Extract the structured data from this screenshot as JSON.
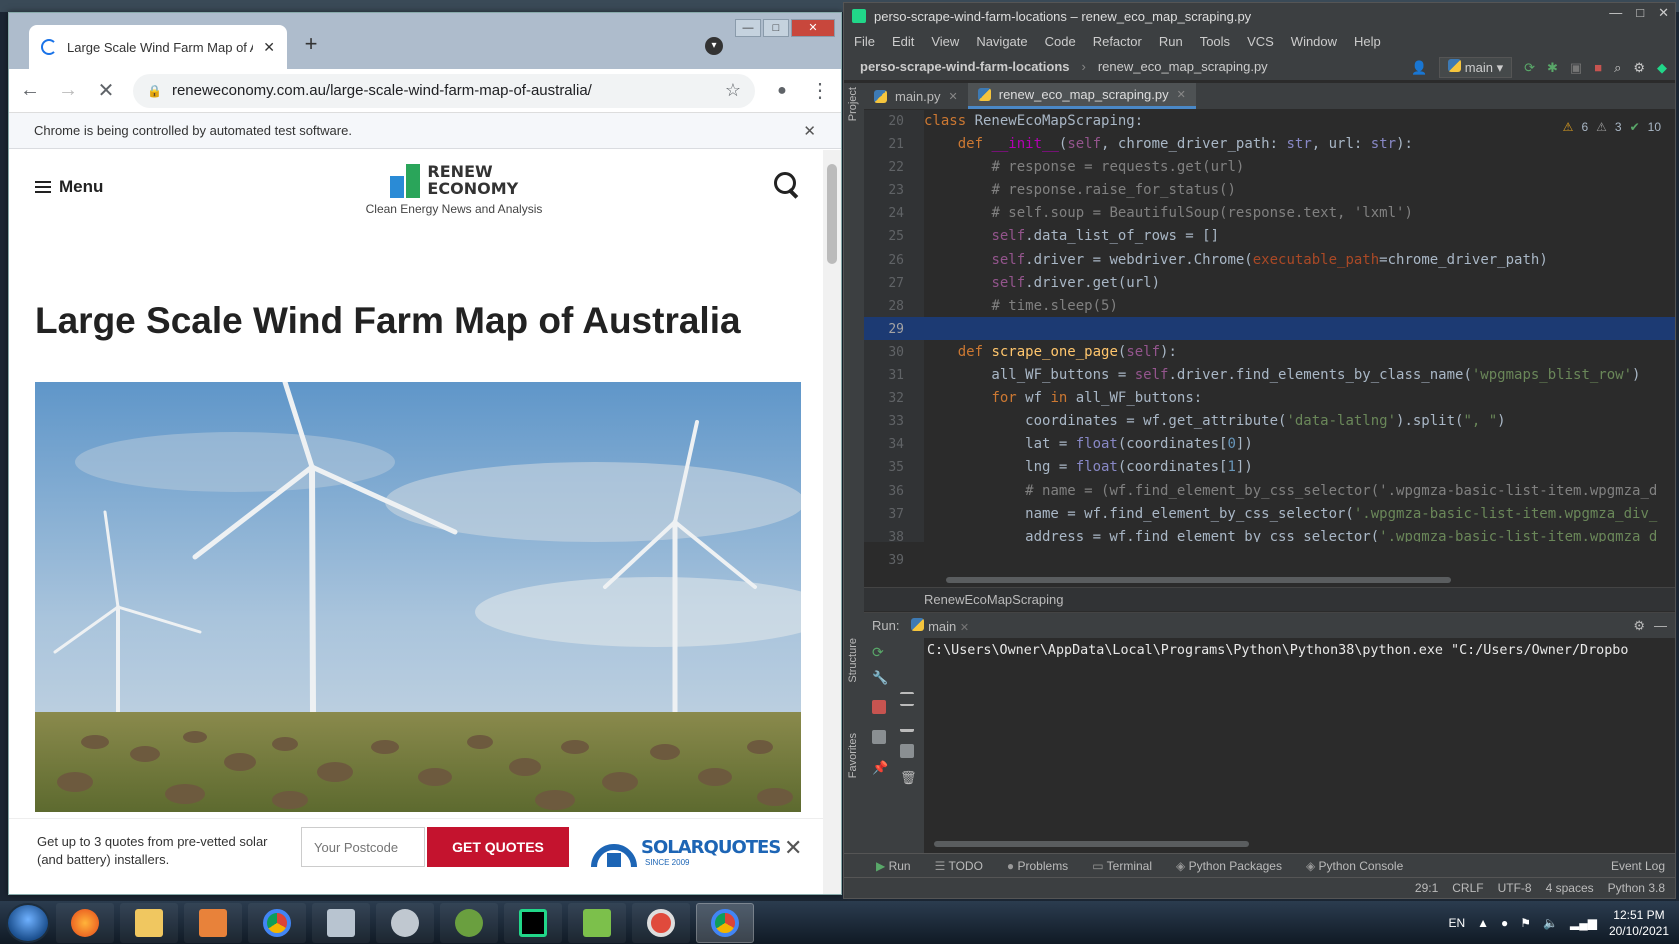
{
  "browser": {
    "tab_title": "Large Scale Wind Farm Map of A",
    "new_tab": "+",
    "win_minimize": "—",
    "win_maximize": "□",
    "win_close": "✕",
    "url": "reneweconomy.com.au/large-scale-wind-farm-map-of-australia/",
    "infobar_text": "Chrome is being controlled by automated test software.",
    "infobar_close": "✕",
    "nav": {
      "back": "←",
      "forward": "→",
      "reload": "✕",
      "star": "☆",
      "menu": "⋮"
    }
  },
  "site": {
    "menu_label": "Menu",
    "logo_line1": "RENEW",
    "logo_line2": "ECONOMY",
    "tagline": "Clean Energy News and Analysis",
    "page_title": "Large Scale Wind Farm Map of Australia",
    "quotes": {
      "text": "Get up to 3 quotes from pre-vetted solar (and battery) installers.",
      "placeholder": "Your Postcode",
      "button": "GET QUOTES",
      "brand": "SOLARQUOTES",
      "brand_since": "SINCE 2009",
      "close": "✕"
    }
  },
  "ide": {
    "window_title": "perso-scrape-wind-farm-locations – renew_eco_map_scraping.py",
    "menu": [
      "File",
      "Edit",
      "View",
      "Navigate",
      "Code",
      "Refactor",
      "Run",
      "Tools",
      "VCS",
      "Window",
      "Help"
    ],
    "project_name": "perso-scrape-wind-farm-locations",
    "file_name": "renew_eco_map_scraping.py",
    "branch": "main",
    "tabs": [
      "main.py",
      "renew_eco_map_scraping.py"
    ],
    "inspections": {
      "warnings": "6",
      "weak": "3",
      "ok": "10"
    },
    "line_numbers": [
      "20",
      "21",
      "22",
      "23",
      "24",
      "25",
      "26",
      "27",
      "28",
      "29",
      "30",
      "31",
      "32",
      "33",
      "34",
      "35",
      "36",
      "37",
      "38",
      "39"
    ],
    "breadcrumb": "RenewEcoMapScraping",
    "run_label": "Run:",
    "run_config": "main",
    "console_line": "C:\\Users\\Owner\\AppData\\Local\\Programs\\Python\\Python38\\python.exe \"C:/Users/Owner/Dropbo",
    "tool_tabs": [
      "Run",
      "TODO",
      "Problems",
      "Terminal",
      "Python Packages",
      "Python Console"
    ],
    "event_log": "Event Log",
    "status": [
      "29:1",
      "CRLF",
      "UTF-8",
      "4 spaces",
      "Python 3.8"
    ],
    "side_labels": [
      "Project",
      "Structure",
      "Favorites"
    ]
  },
  "taskbar": {
    "lang": "EN",
    "time": "12:51 PM",
    "date": "20/10/2021"
  }
}
